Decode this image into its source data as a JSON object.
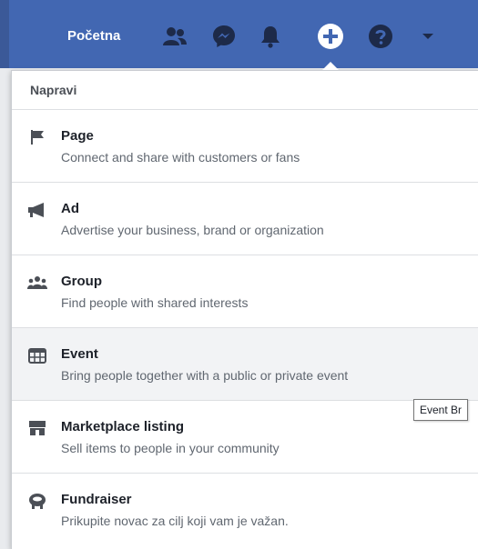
{
  "topbar": {
    "home_label": "Početna",
    "icons": [
      "friends-icon",
      "messenger-icon",
      "notifications-icon",
      "create-icon",
      "help-icon",
      "account-menu-caret-icon"
    ],
    "color": "#4267b2"
  },
  "dropdown": {
    "header": "Napravi",
    "items": [
      {
        "icon": "flag-icon",
        "title": "Page",
        "description": "Connect and share with customers or fans"
      },
      {
        "icon": "megaphone-icon",
        "title": "Ad",
        "description": "Advertise your business, brand or organization"
      },
      {
        "icon": "group-icon",
        "title": "Group",
        "description": "Find people with shared interests"
      },
      {
        "icon": "calendar-icon",
        "title": "Event",
        "description": "Bring people together with a public or private event"
      },
      {
        "icon": "storefront-icon",
        "title": "Marketplace listing",
        "description": "Sell items to people in your community"
      },
      {
        "icon": "piggy-bank-icon",
        "title": "Fundraiser",
        "description": "Prikupite novac za cilj koji vam je važan."
      }
    ]
  },
  "tooltip": {
    "text": "Event Br"
  }
}
